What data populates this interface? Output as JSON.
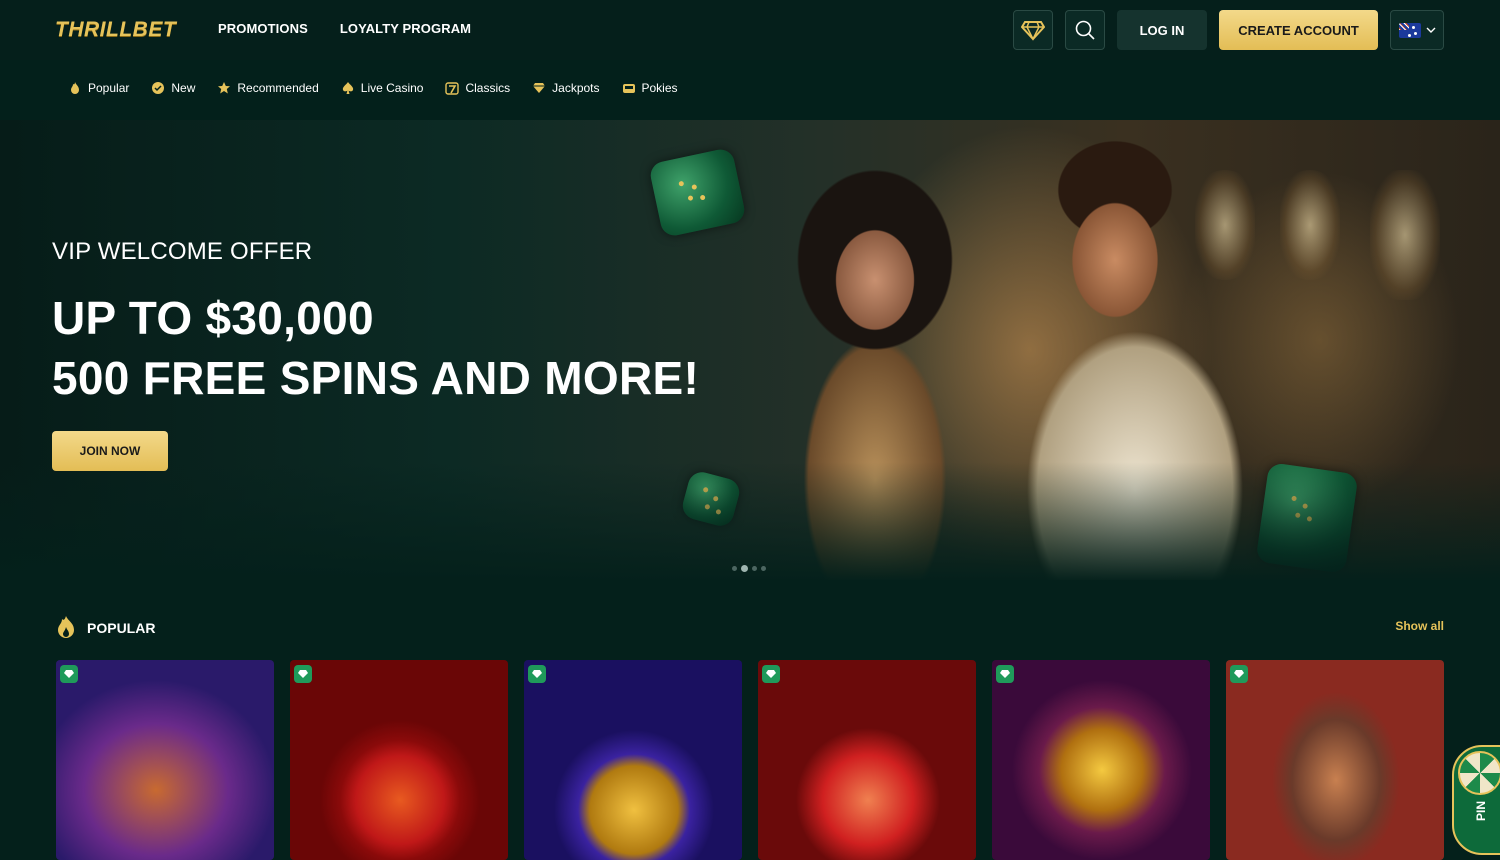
{
  "brand": {
    "logo_text": "THRILLBET"
  },
  "topnav": {
    "items": [
      "PROMOTIONS",
      "LOYALTY PROGRAM"
    ]
  },
  "header": {
    "login_label": "LOG IN",
    "create_label": "CREATE ACCOUNT",
    "language_flag": "australia-flag-icon"
  },
  "categories": [
    {
      "label": "Popular",
      "icon": "flame-icon"
    },
    {
      "label": "New",
      "icon": "new-badge-icon"
    },
    {
      "label": "Recommended",
      "icon": "star-icon"
    },
    {
      "label": "Live Casino",
      "icon": "spade-icon"
    },
    {
      "label": "Classics",
      "icon": "seven-icon"
    },
    {
      "label": "Jackpots",
      "icon": "diamond-icon"
    },
    {
      "label": "Pokies",
      "icon": "slot-machine-icon"
    }
  ],
  "hero": {
    "subtitle": "VIP WELCOME OFFER",
    "line1": "UP TO $30,000",
    "line2": "500 FREE SPINS AND MORE!",
    "cta": "JOIN NOW",
    "slides": 4,
    "active_slide": 2
  },
  "popular": {
    "title": "POPULAR",
    "show_all": "Show all",
    "games": [
      {
        "name": "wolf-game"
      },
      {
        "name": "chili-game"
      },
      {
        "name": "coin-strike-game"
      },
      {
        "name": "jester-game"
      },
      {
        "name": "dragon-pearls-game"
      },
      {
        "name": "cleopatra-game"
      }
    ]
  },
  "wheel": {
    "label": "PIN"
  },
  "colors": {
    "gold": "#e6c35a",
    "bg": "#04201b",
    "green": "#1f9a5a"
  }
}
